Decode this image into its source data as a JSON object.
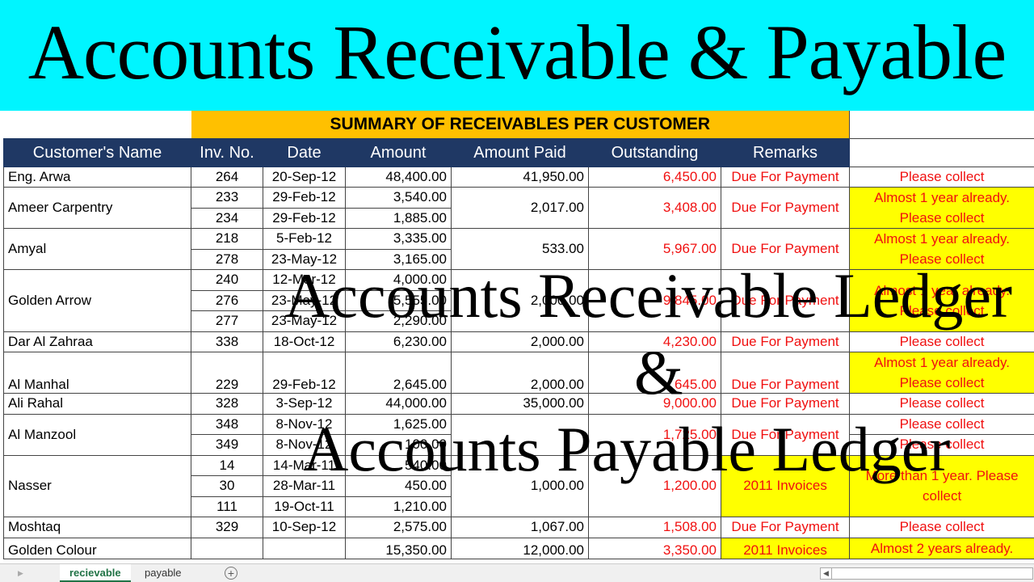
{
  "banner_title": "Accounts Receivable & Payable",
  "overlay": {
    "line1": "Accounts Receivable Ledger",
    "line2": "&",
    "line3": "Accounts Payable Ledger"
  },
  "sheet": {
    "summary_title": "SUMMARY OF RECEIVABLES PER CUSTOMER",
    "headers": [
      "Customer's Name",
      "Inv. No.",
      "Date",
      "Amount",
      "Amount Paid",
      "Outstanding",
      "Remarks"
    ],
    "colors": {
      "header_bg": "#1f3864",
      "summary_bg": "#ffc000",
      "highlight": "#ffff00",
      "alert_text": "#f01010",
      "banner_bg": "#00f5ff"
    },
    "rows": [
      {
        "customer": "Eng. Arwa",
        "invoices": [
          {
            "no": "264",
            "date": "20-Sep-12",
            "amount": "48,400.00"
          }
        ],
        "paid": "41,950.00",
        "outstanding": "6,450.00",
        "remarks": "Due For Payment",
        "notes": [
          "Please collect"
        ],
        "note_highlight": false
      },
      {
        "customer": "Ameer Carpentry",
        "invoices": [
          {
            "no": "233",
            "date": "29-Feb-12",
            "amount": "3,540.00"
          },
          {
            "no": "234",
            "date": "29-Feb-12",
            "amount": "1,885.00"
          }
        ],
        "paid": "2,017.00",
        "outstanding": "3,408.00",
        "remarks": "Due For Payment",
        "notes": [
          "Almost 1 year already. Please collect"
        ],
        "note_highlight": true
      },
      {
        "customer": "Amyal",
        "invoices": [
          {
            "no": "218",
            "date": "5-Feb-12",
            "amount": "3,335.00"
          },
          {
            "no": "278",
            "date": "23-May-12",
            "amount": "3,165.00"
          }
        ],
        "paid": "533.00",
        "outstanding": "5,967.00",
        "remarks": "Due For Payment",
        "notes": [
          "Almost 1 year already. Please collect"
        ],
        "note_highlight": true
      },
      {
        "customer": "Golden Arrow",
        "invoices": [
          {
            "no": "240",
            "date": "12-Mar-12",
            "amount": "4,000.00"
          },
          {
            "no": "276",
            "date": "23-May-12",
            "amount": "5,555.00"
          },
          {
            "no": "277",
            "date": "23-May-12",
            "amount": "2,290.00"
          }
        ],
        "paid": "2,000.00",
        "outstanding": "9,845.00",
        "remarks": "Due For Payment",
        "notes": [
          "Almost 1 year already. Please collect"
        ],
        "note_highlight": true
      },
      {
        "customer": "Dar Al Zahraa",
        "invoices": [
          {
            "no": "338",
            "date": "18-Oct-12",
            "amount": "6,230.00"
          }
        ],
        "paid": "2,000.00",
        "outstanding": "4,230.00",
        "remarks": "Due For Payment",
        "notes": [
          "Please collect"
        ],
        "note_highlight": false
      },
      {
        "customer": "Al Manhal",
        "tall": true,
        "invoices": [
          {
            "no": "229",
            "date": "29-Feb-12",
            "amount": "2,645.00"
          }
        ],
        "paid": "2,000.00",
        "outstanding": "645.00",
        "remarks": "Due For Payment",
        "notes": [
          "Almost 1 year already. Please collect"
        ],
        "note_highlight": true
      },
      {
        "customer": "Ali Rahal",
        "invoices": [
          {
            "no": "328",
            "date": "3-Sep-12",
            "amount": "44,000.00"
          }
        ],
        "paid": "35,000.00",
        "outstanding": "9,000.00",
        "remarks": "Due For Payment",
        "notes": [
          "Please collect"
        ],
        "note_highlight": false
      },
      {
        "customer": "Al Manzool",
        "invoices": [
          {
            "no": "348",
            "date": "8-Nov-12",
            "amount": "1,625.00"
          },
          {
            "no": "349",
            "date": "8-Nov-12",
            "amount": "100.00"
          }
        ],
        "paid": "",
        "outstanding": "1,725.00",
        "remarks": "Due For Payment",
        "notes": [
          "Please collect",
          "Please collect"
        ],
        "note_highlight": false
      },
      {
        "customer": "Nasser",
        "invoices": [
          {
            "no": "14",
            "date": "14-Mar-11",
            "amount": "540.00"
          },
          {
            "no": "30",
            "date": "28-Mar-11",
            "amount": "450.00"
          },
          {
            "no": "111",
            "date": "19-Oct-11",
            "amount": "1,210.00"
          }
        ],
        "paid": "1,000.00",
        "outstanding": "1,200.00",
        "remarks": "2011 Invoices",
        "remarks_highlight": true,
        "notes": [
          "More than 1 year.  Please collect"
        ],
        "note_highlight": true
      },
      {
        "customer": "Moshtaq",
        "invoices": [
          {
            "no": "329",
            "date": "10-Sep-12",
            "amount": "2,575.00"
          }
        ],
        "paid": "1,067.00",
        "outstanding": "1,508.00",
        "remarks": "Due For Payment",
        "notes": [
          "Please collect"
        ],
        "note_highlight": false
      },
      {
        "customer": "Golden Colour",
        "tall": true,
        "invoices": [
          {
            "no": "",
            "date": "",
            "amount": "15,350.00"
          }
        ],
        "paid": "12,000.00",
        "outstanding": "3,350.00",
        "remarks": "2011 Invoices",
        "remarks_highlight": true,
        "notes": [
          "Almost 2 years already."
        ],
        "note_highlight": true
      }
    ]
  },
  "tabs": {
    "items": [
      "recievable",
      "payable"
    ],
    "active": "recievable",
    "add_icon": "plus-circle-icon"
  }
}
